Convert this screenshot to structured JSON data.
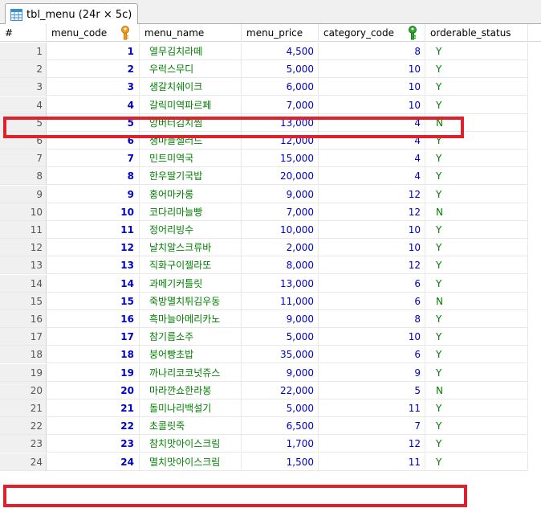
{
  "tab": {
    "title": "tbl_menu (24r × 5c)"
  },
  "columns": [
    {
      "key": "num",
      "label": "#"
    },
    {
      "key": "menu_code",
      "label": "menu_code"
    },
    {
      "key": "menu_name",
      "label": "menu_name"
    },
    {
      "key": "menu_price",
      "label": "menu_price"
    },
    {
      "key": "category_code",
      "label": "category_code"
    },
    {
      "key": "orderable_status",
      "label": "orderable_status"
    }
  ],
  "colors": {
    "key_primary": "#f0a020",
    "key_foreign": "#2fa82f",
    "highlight": "#e0202a",
    "number": "#0000cc",
    "text": "#008000"
  },
  "rows": [
    {
      "num": "1",
      "code": "1",
      "name": "열무김치라떼",
      "price": "4,500",
      "cat": "8",
      "ord": "Y"
    },
    {
      "num": "2",
      "code": "2",
      "name": "우럭스무디",
      "price": "5,000",
      "cat": "10",
      "ord": "Y"
    },
    {
      "num": "3",
      "code": "3",
      "name": "생갈치쉐이크",
      "price": "6,000",
      "cat": "10",
      "ord": "Y"
    },
    {
      "num": "4",
      "code": "4",
      "name": "갈릭미역파르페",
      "price": "7,000",
      "cat": "10",
      "ord": "Y"
    },
    {
      "num": "5",
      "code": "5",
      "name": "앙버터김치찜",
      "price": "13,000",
      "cat": "4",
      "ord": "N"
    },
    {
      "num": "6",
      "code": "6",
      "name": "생마늘샐러드",
      "price": "12,000",
      "cat": "4",
      "ord": "Y"
    },
    {
      "num": "7",
      "code": "7",
      "name": "민트미역국",
      "price": "15,000",
      "cat": "4",
      "ord": "Y"
    },
    {
      "num": "8",
      "code": "8",
      "name": "한우딸기국밥",
      "price": "20,000",
      "cat": "4",
      "ord": "Y"
    },
    {
      "num": "9",
      "code": "9",
      "name": "홍어마카롱",
      "price": "9,000",
      "cat": "12",
      "ord": "Y"
    },
    {
      "num": "10",
      "code": "10",
      "name": "코다리마늘빵",
      "price": "7,000",
      "cat": "12",
      "ord": "N"
    },
    {
      "num": "11",
      "code": "11",
      "name": "정어리빙수",
      "price": "10,000",
      "cat": "10",
      "ord": "Y"
    },
    {
      "num": "12",
      "code": "12",
      "name": "날치알스크류바",
      "price": "2,000",
      "cat": "10",
      "ord": "Y"
    },
    {
      "num": "13",
      "code": "13",
      "name": "직화구이젤라또",
      "price": "8,000",
      "cat": "12",
      "ord": "Y"
    },
    {
      "num": "14",
      "code": "14",
      "name": "과메기커틀릿",
      "price": "13,000",
      "cat": "6",
      "ord": "Y"
    },
    {
      "num": "15",
      "code": "15",
      "name": "죽방멸치튀김우동",
      "price": "11,000",
      "cat": "6",
      "ord": "N"
    },
    {
      "num": "16",
      "code": "16",
      "name": "흑마늘아메리카노",
      "price": "9,000",
      "cat": "8",
      "ord": "Y"
    },
    {
      "num": "17",
      "code": "17",
      "name": "참기름소주",
      "price": "5,000",
      "cat": "10",
      "ord": "Y"
    },
    {
      "num": "18",
      "code": "18",
      "name": "붕어빵초밥",
      "price": "35,000",
      "cat": "6",
      "ord": "Y"
    },
    {
      "num": "19",
      "code": "19",
      "name": "까나리코코넛쥬스",
      "price": "9,000",
      "cat": "9",
      "ord": "Y"
    },
    {
      "num": "20",
      "code": "20",
      "name": "마라깐쇼한라봉",
      "price": "22,000",
      "cat": "5",
      "ord": "N"
    },
    {
      "num": "21",
      "code": "21",
      "name": "돌미나리백설기",
      "price": "5,000",
      "cat": "11",
      "ord": "Y"
    },
    {
      "num": "22",
      "code": "22",
      "name": "초콜릿죽",
      "price": "6,500",
      "cat": "7",
      "ord": "Y"
    },
    {
      "num": "23",
      "code": "23",
      "name": "참치맛아이스크림",
      "price": "1,700",
      "cat": "12",
      "ord": "Y"
    },
    {
      "num": "24",
      "code": "24",
      "name": "멸치맛아이스크림",
      "price": "1,500",
      "cat": "11",
      "ord": "Y"
    }
  ]
}
